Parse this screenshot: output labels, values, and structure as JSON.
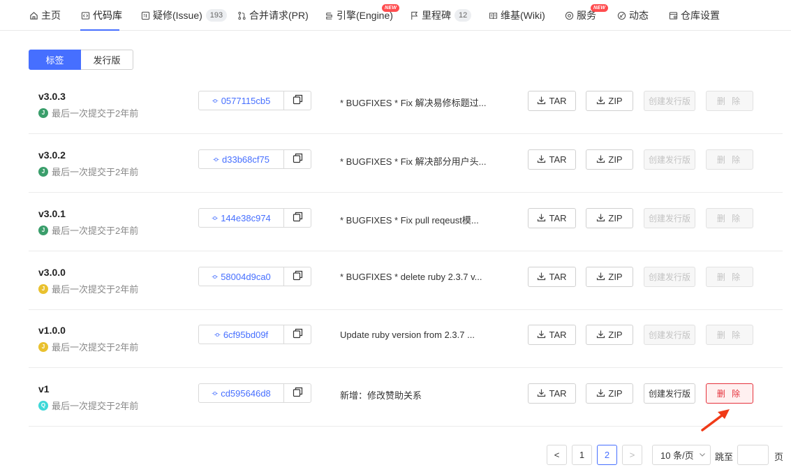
{
  "nav": {
    "items": [
      {
        "label": "主页",
        "icon": "home-icon"
      },
      {
        "label": "代码库",
        "icon": "code-icon"
      },
      {
        "label": "疑修(Issue)",
        "icon": "issue-icon",
        "count": "193"
      },
      {
        "label": "合并请求(PR)",
        "icon": "merge-icon"
      },
      {
        "label": "引擎(Engine)",
        "icon": "engine-icon",
        "badge": "NEW"
      },
      {
        "label": "里程碑",
        "icon": "flag-icon",
        "count": "12"
      },
      {
        "label": "维基(Wiki)",
        "icon": "book-icon"
      },
      {
        "label": "服务",
        "icon": "service-icon",
        "badge": "NEW"
      },
      {
        "label": "动态",
        "icon": "activity-icon"
      },
      {
        "label": "仓库设置",
        "icon": "settings-icon"
      }
    ]
  },
  "tabs": [
    {
      "label": "标签",
      "active": true
    },
    {
      "label": "发行版",
      "active": false
    }
  ],
  "tags": [
    {
      "name": "v3.0.3",
      "avatar": "J",
      "avatar_color": "#3a9e6b",
      "subtitle": "最后一次提交于2年前",
      "hash": "0577115cb5",
      "message": "* BUGFIXES * Fix 解决易修标题过...",
      "tar": "TAR",
      "zip": "ZIP",
      "release": "创建发行版",
      "delete": "删 除",
      "enabled": false
    },
    {
      "name": "v3.0.2",
      "avatar": "J",
      "avatar_color": "#3a9e6b",
      "subtitle": "最后一次提交于2年前",
      "hash": "d33b68cf75",
      "message": "* BUGFIXES * Fix 解决部分用户头...",
      "tar": "TAR",
      "zip": "ZIP",
      "release": "创建发行版",
      "delete": "删 除",
      "enabled": false
    },
    {
      "name": "v3.0.1",
      "avatar": "J",
      "avatar_color": "#3a9e6b",
      "subtitle": "最后一次提交于2年前",
      "hash": "144e38c974",
      "message": "* BUGFIXES * Fix pull reqeust模...",
      "tar": "TAR",
      "zip": "ZIP",
      "release": "创建发行版",
      "delete": "删 除",
      "enabled": false
    },
    {
      "name": "v3.0.0",
      "avatar": "J",
      "avatar_color": "#e9c12f",
      "subtitle": "最后一次提交于2年前",
      "hash": "58004d9ca0",
      "message": "* BUGFIXES * delete ruby 2.3.7 v...",
      "tar": "TAR",
      "zip": "ZIP",
      "release": "创建发行版",
      "delete": "删 除",
      "enabled": false
    },
    {
      "name": "v1.0.0",
      "avatar": "J",
      "avatar_color": "#e9c12f",
      "subtitle": "最后一次提交于2年前",
      "hash": "6cf95bd09f",
      "message": "Update ruby version from 2.3.7 ...",
      "tar": "TAR",
      "zip": "ZIP",
      "release": "创建发行版",
      "delete": "删 除",
      "enabled": false
    },
    {
      "name": "v1",
      "avatar": "Q",
      "avatar_color": "#3ed8d8",
      "subtitle": "最后一次提交于2年前",
      "hash": "cd595646d8",
      "message": "新增：修改赞助关系",
      "tar": "TAR",
      "zip": "ZIP",
      "release": "创建发行版",
      "delete": "删 除",
      "enabled": true
    }
  ],
  "pagination": {
    "prev": "<",
    "pages": [
      "1",
      "2"
    ],
    "current": "2",
    "next": ">",
    "page_size": "10 条/页",
    "jump_label": "跳至",
    "page_unit": "页"
  },
  "colors": {
    "accent": "#466fff",
    "danger": "#e5323c",
    "arrow": "#f03a17"
  }
}
